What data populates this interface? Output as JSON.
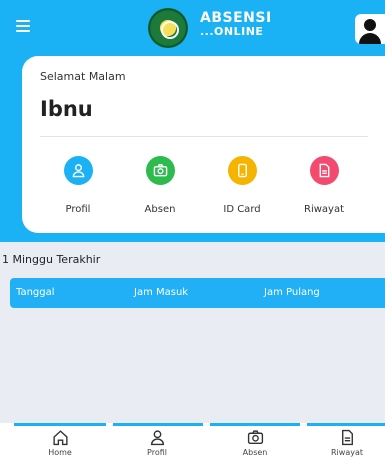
{
  "header": {
    "menu_icon": "hamburger-icon",
    "logo_line1": "ABSENSI",
    "logo_line2": "...ONLINE",
    "avatar_icon": "user-icon"
  },
  "greeting": {
    "salutation": "Selamat Malam",
    "name": "Ibnu"
  },
  "menu": [
    {
      "label": "Profil",
      "icon": "user-icon",
      "color": "#1ab2f5"
    },
    {
      "label": "Absen",
      "icon": "camera-icon",
      "color": "#2dbb4e"
    },
    {
      "label": "ID Card",
      "icon": "id-card-icon",
      "color": "#f5b400"
    },
    {
      "label": "Riwayat",
      "icon": "document-icon",
      "color": "#f34a70"
    }
  ],
  "history": {
    "title": "1 Minggu Terakhir",
    "columns": [
      "Tanggal",
      "Jam Masuk",
      "Jam Pulang"
    ],
    "rows": []
  },
  "bottom_nav": [
    {
      "label": "Home",
      "icon": "home-icon"
    },
    {
      "label": "Profil",
      "icon": "user-icon"
    },
    {
      "label": "Absen",
      "icon": "camera-icon"
    },
    {
      "label": "Riwayat",
      "icon": "document-icon"
    }
  ],
  "colors": {
    "primary": "#1ab2f5",
    "background": "#e9ecf3"
  }
}
